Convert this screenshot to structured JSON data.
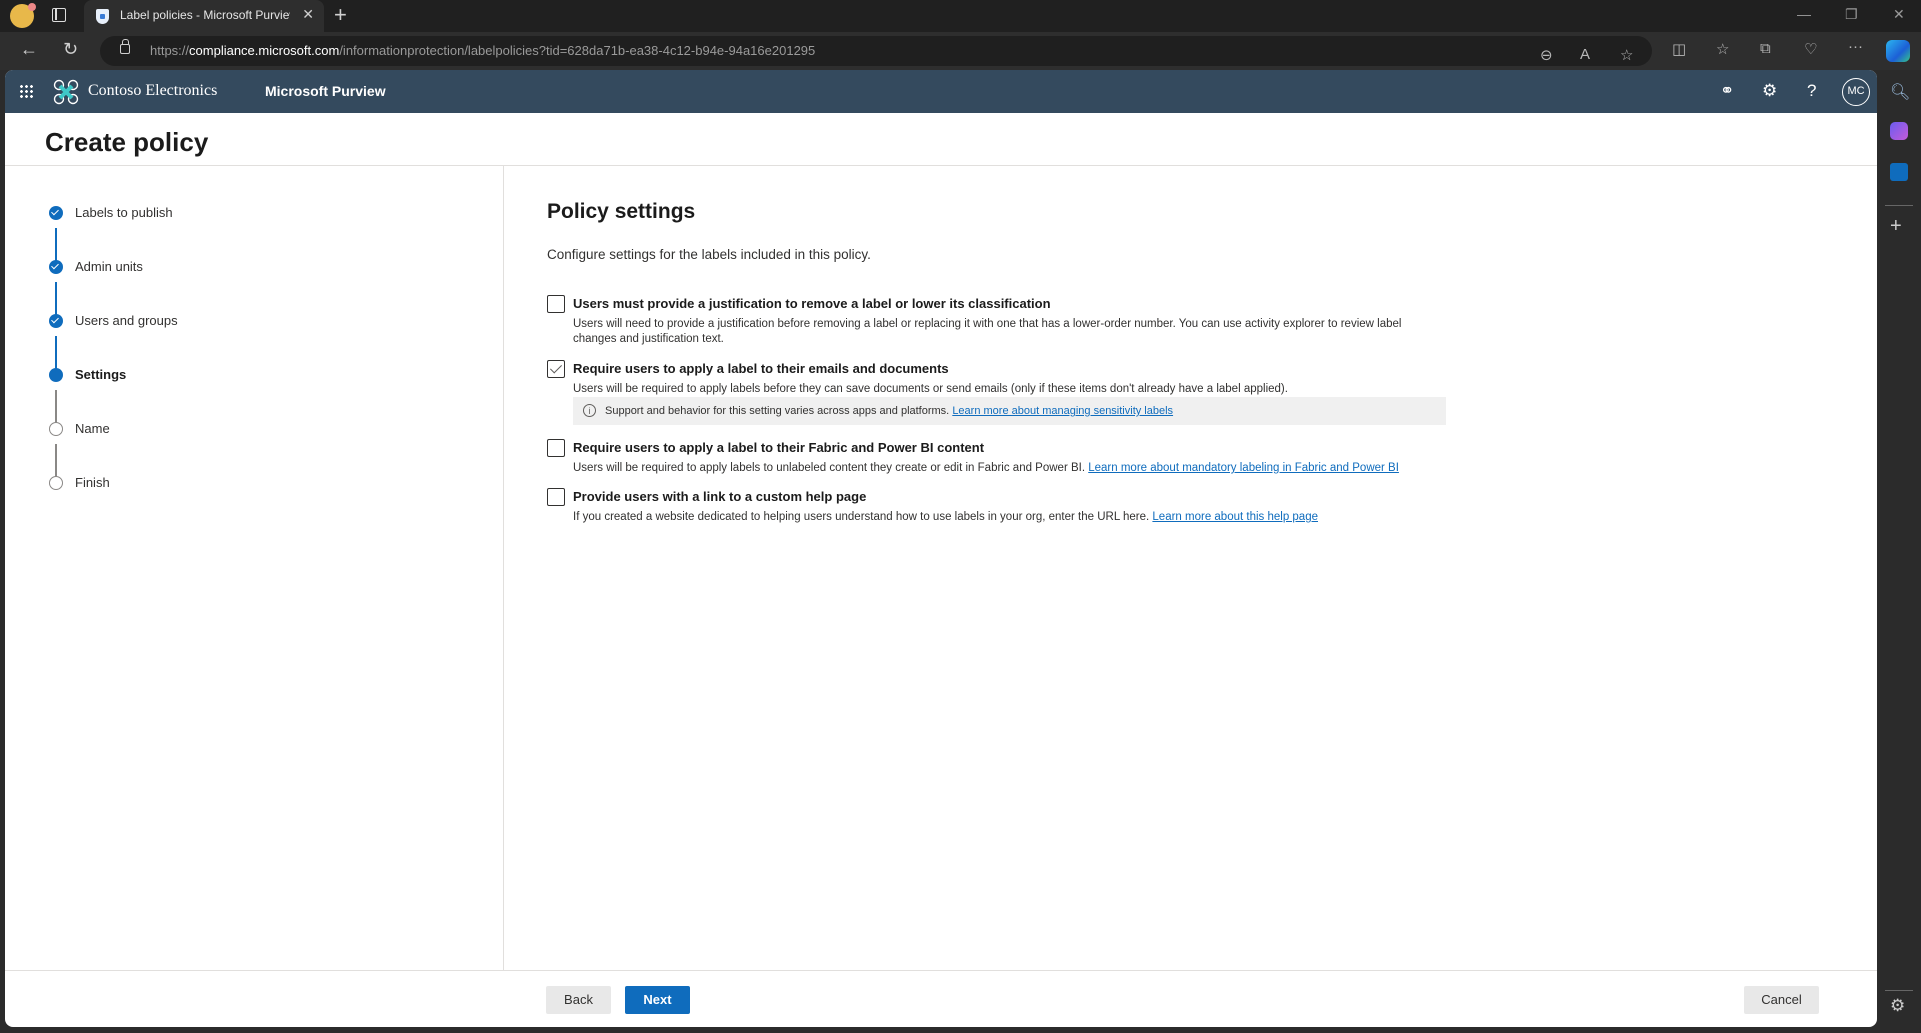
{
  "browser": {
    "tab_title": "Label policies - Microsoft Purview",
    "url_prefix": "https://",
    "url_host": "compliance.microsoft.com",
    "url_path": "/informationprotection/labelpolicies?tid=628da71b-ea38-4c12-b94e-94a16e201295"
  },
  "suite": {
    "org_name": "Contoso Electronics",
    "product_name": "Microsoft Purview",
    "avatar_initials": "MC"
  },
  "page": {
    "title": "Create policy"
  },
  "steps": [
    {
      "label": "Labels to publish",
      "state": "done"
    },
    {
      "label": "Admin units",
      "state": "done"
    },
    {
      "label": "Users and groups",
      "state": "done"
    },
    {
      "label": "Settings",
      "state": "current"
    },
    {
      "label": "Name",
      "state": "todo"
    },
    {
      "label": "Finish",
      "state": "todo"
    }
  ],
  "content": {
    "title": "Policy settings",
    "description": "Configure settings for the labels included in this policy.",
    "settings": [
      {
        "title": "Users must provide a justification to remove a label or lower its classification",
        "checked": false,
        "description": "Users will need to provide a justification before removing a label or replacing it with one that has a lower-order number. You can use activity explorer to review label changes and justification text."
      },
      {
        "title": "Require users to apply a label to their emails and documents",
        "checked": true,
        "description": "Users will be required to apply labels before they can save documents or send emails (only if these items don't already have a label applied).",
        "info_text": "Support and behavior for this setting varies across apps and platforms.",
        "info_link": "Learn more about managing sensitivity labels"
      },
      {
        "title": "Require users to apply a label to their Fabric and Power BI content",
        "checked": false,
        "description": "Users will be required to apply labels to unlabeled content they create or edit in Fabric and Power BI.",
        "link": "Learn more about mandatory labeling in Fabric and Power BI"
      },
      {
        "title": "Provide users with a link to a custom help page",
        "checked": false,
        "description": "If you created a website dedicated to helping users understand how to use labels in your org, enter the URL here.",
        "link": "Learn more about this help page"
      }
    ]
  },
  "footer": {
    "back_label": "Back",
    "next_label": "Next",
    "cancel_label": "Cancel"
  },
  "colors": {
    "accent": "#0f6cbd",
    "suite_bar": "#344a5e"
  }
}
